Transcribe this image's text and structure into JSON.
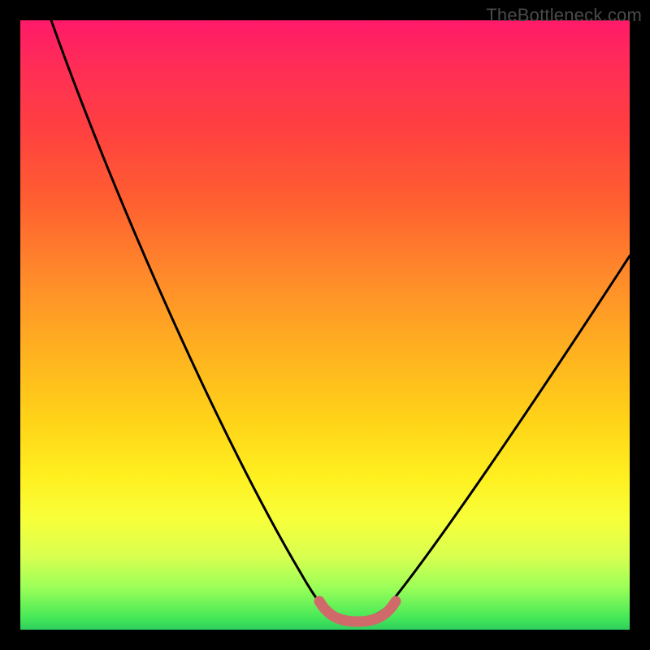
{
  "attribution": "TheBottleneck.com",
  "chart_data": {
    "type": "line",
    "title": "",
    "xlabel": "",
    "ylabel": "",
    "xlim": [
      0,
      100
    ],
    "ylim": [
      0,
      100
    ],
    "series": [
      {
        "name": "bottleneck-curve",
        "x": [
          5,
          10,
          15,
          20,
          25,
          30,
          35,
          40,
          45,
          48,
          50,
          53,
          56,
          58,
          60,
          63,
          68,
          75,
          82,
          90,
          98,
          100
        ],
        "y": [
          100,
          90,
          80,
          70,
          60,
          50,
          40,
          30,
          18,
          9,
          3,
          1,
          1,
          1,
          2,
          5,
          12,
          23,
          35,
          48,
          61,
          65
        ]
      },
      {
        "name": "optimal-zone-marker",
        "x": [
          50,
          60
        ],
        "y": [
          1,
          1
        ]
      }
    ],
    "annotations": [],
    "background_gradient": {
      "top": "#ff1a6a",
      "mid": "#ffd418",
      "bottom": "#2fcf5e"
    }
  }
}
